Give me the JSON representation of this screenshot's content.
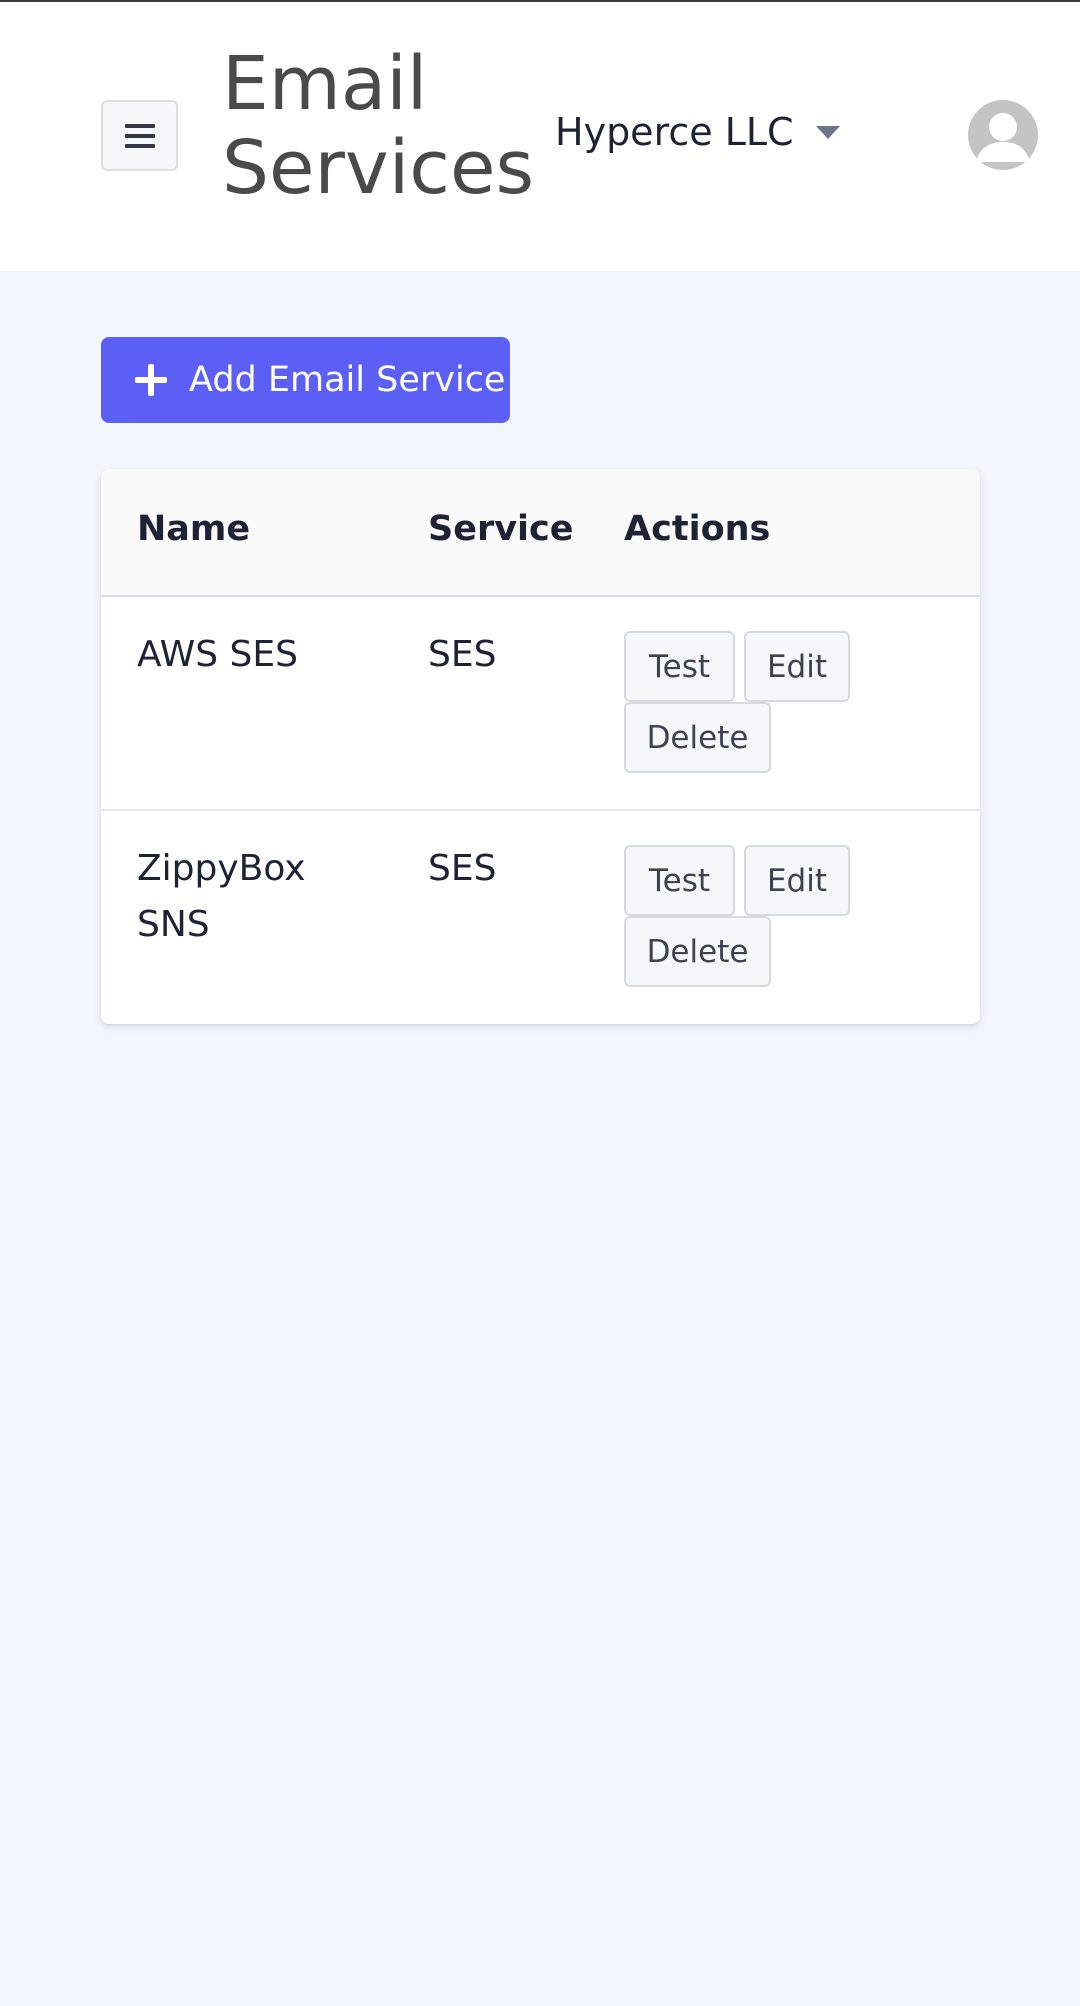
{
  "header": {
    "menu_icon": "hamburger-icon",
    "title": "Email Services",
    "organization": "Hyperce LLC",
    "avatar_icon": "user-avatar-icon"
  },
  "toolbar": {
    "add_icon": "plus-icon",
    "add_label": "Add Email Service"
  },
  "table": {
    "columns": [
      "Name",
      "Service",
      "Actions"
    ],
    "rows": [
      {
        "name": "AWS SES",
        "service": "SES",
        "actions": [
          "Test",
          "Edit",
          "Delete"
        ]
      },
      {
        "name": "ZippyBox SNS",
        "service": "SES",
        "actions": [
          "Test",
          "Edit",
          "Delete"
        ]
      }
    ]
  },
  "colors": {
    "accent": "#5b5ff6",
    "page_background": "#f2f6fd"
  }
}
